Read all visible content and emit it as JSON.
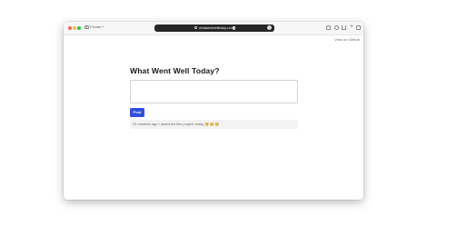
{
  "browser": {
    "tab_group_label": "Private",
    "address": "whatwentwelltoday.com"
  },
  "header": {
    "github_link": "View on GitHub"
  },
  "main": {
    "title": "What Went Well Today?",
    "post_button": "Post",
    "entries": [
      {
        "time": "24 minutes ago",
        "text": "I launched this project today",
        "emoji": "🥳🥳🥳"
      }
    ]
  },
  "colors": {
    "accent": "#2f4fe0",
    "entry_bg": "#f3f3f3"
  }
}
